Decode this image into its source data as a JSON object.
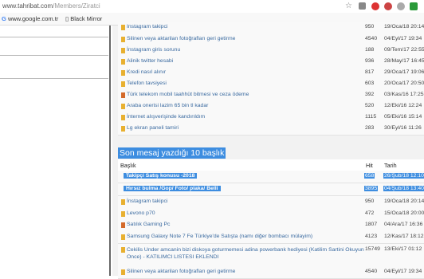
{
  "browser": {
    "url_host": "www.tahribat.com",
    "url_path": "/Members/Ziratci"
  },
  "bookmarks": [
    {
      "label": "www.google.com.tr"
    },
    {
      "label": "Black Mirror"
    }
  ],
  "colors": {
    "accent": "#3d8de0",
    "link": "#3a6aa0",
    "folder": "#e8b030"
  },
  "top_rows": [
    {
      "title": "Instagram takipci",
      "hits": "950",
      "date": "19/Oca/18 20:14",
      "icon": "folder-icon"
    },
    {
      "title": "Silinen veya aktarilan fotoğrafları geri getirme",
      "hits": "4540",
      "date": "04/Eyl/17 19:34",
      "icon": "folder-icon"
    },
    {
      "title": "İnstagram giris sorunu",
      "hits": "188",
      "date": "09/Tem/17 22:55",
      "icon": "folder-icon"
    },
    {
      "title": "Alinik twitter hesabi",
      "hits": "936",
      "date": "28/May/17 16:45",
      "icon": "folder-icon"
    },
    {
      "title": "Kredi nasıl alınır",
      "hits": "817",
      "date": "29/Oca/17 19:06",
      "icon": "folder-icon"
    },
    {
      "title": "Telefon tavsiyesi",
      "hits": "603",
      "date": "20/Oca/17 20:50",
      "icon": "folder-icon"
    },
    {
      "title": "Türk telekom mobil taahhüt bitmesi ve ceza ödeme",
      "hits": "392",
      "date": "03/Kas/16 17:25",
      "icon": "image-icon"
    },
    {
      "title": "Araba onerisi lazim 65 bin tl kadar",
      "hits": "520",
      "date": "12/Eki/16 12:24",
      "icon": "folder-icon"
    },
    {
      "title": "İnternet alışverişinde kandırıldım",
      "hits": "1115",
      "date": "05/Eki/16 15:14",
      "icon": "folder-icon"
    },
    {
      "title": "Lg ekran paneli tamiri",
      "hits": "283",
      "date": "30/Eyl/16 11:26",
      "icon": "folder-icon"
    }
  ],
  "section": {
    "title": "Son mesaj yazdığı 10 başlık",
    "col_title": "Başlık",
    "col_hits": "Hit",
    "col_date": "Tarih"
  },
  "bottom_rows": [
    {
      "title": "Takipçi Satış konusu -2018",
      "hits": "658",
      "date": "26/Şub/18 12:10",
      "icon": "folder-icon"
    },
    {
      "title": "Hırsız bulma /Gop/ Foto/ plaka/ Belli",
      "hits": "3895",
      "date": "04/Şub/18 13:40",
      "icon": "folder-icon"
    },
    {
      "title": "İnstagram takipci",
      "hits": "950",
      "date": "19/Oca/18 20:14",
      "icon": "folder-icon"
    },
    {
      "title": "Levono p70",
      "hits": "472",
      "date": "15/Oca/18 20:00",
      "icon": "folder-icon"
    },
    {
      "title": "Satılık Gaming Pc",
      "hits": "1807",
      "date": "04/Ara/17 16:36",
      "icon": "image-icon"
    },
    {
      "title": "Samsung Galaxy Note 7 Fe Türkiye'de Satışta (namı diğer bombacı mülayim)",
      "hits": "4123",
      "date": "12/Kas/17 18:12",
      "icon": "folder-icon"
    },
    {
      "title": "Cekilis Under amcanin bizi diskoya goturmemesi adina powerbank hediyesi (Katilim Sartini Okuyun Once) - KATILIMCI LISTESI EKLENDI",
      "hits": "15749",
      "date": "13/Eki/17 01:12",
      "icon": "folder-icon"
    },
    {
      "title": "Silinen veya aktarilan fotoğrafları geri getirme",
      "hits": "4540",
      "date": "04/Eyl/17 19:34",
      "icon": "folder-icon"
    }
  ]
}
